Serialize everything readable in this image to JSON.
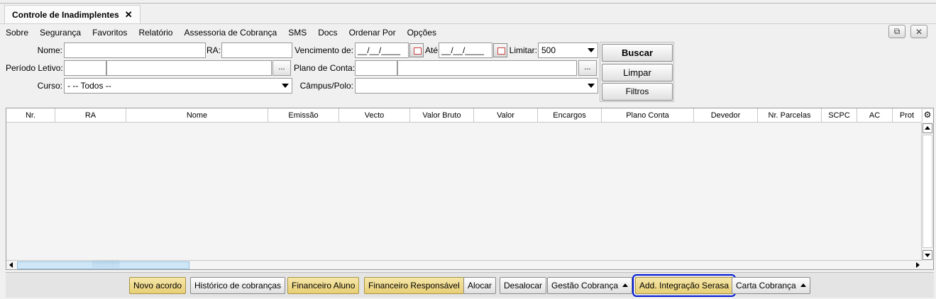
{
  "tab": {
    "title": "Controle de Inadimplentes",
    "close": "✕"
  },
  "menu": [
    "Sobre",
    "Segurança",
    "Favoritos",
    "Relatório",
    "Assessoria de Cobrança",
    "SMS",
    "Docs",
    "Ordenar Por",
    "Opções"
  ],
  "window_buttons": {
    "popout": "⧉",
    "close": "✕"
  },
  "form": {
    "nome_label": "Nome:",
    "ra_label": "RA:",
    "vencimento_label": "Vencimento de:",
    "vencimento_de": "__/__/____",
    "ate_label": "Até",
    "vencimento_ate": "__/__/____",
    "limitar_label": "Limitar:",
    "limitar_value": "500",
    "periodo_label": "Período Letivo:",
    "plano_label": "Plano de Conta:",
    "curso_label": "Curso:",
    "curso_value": "- -- Todos --",
    "campus_label": "Câmpus/Polo:",
    "dots": "..."
  },
  "buttons": {
    "buscar": "Buscar",
    "limpar": "Limpar",
    "filtros": "Filtros"
  },
  "grid_columns": [
    "Nr.",
    "RA",
    "Nome",
    "Emissão",
    "Vecto",
    "Valor Bruto",
    "Valor",
    "Encargos",
    "Plano Conta",
    "Devedor",
    "Nr. Parcelas",
    "SCPC",
    "AC",
    "Prot"
  ],
  "grid_scroll_thumb": "░░░░░░",
  "footer_buttons": {
    "novo_acordo": "Novo acordo",
    "historico": "Histórico de cobranças",
    "fin_aluno": "Financeiro Aluno",
    "fin_resp": "Financeiro Responsável",
    "alocar": "Alocar",
    "desalocar": "Desalocar",
    "gestao": "Gestão Cobrança",
    "add_serasa": "Add. Integração Serasa",
    "carta": "Carta Cobrança"
  }
}
